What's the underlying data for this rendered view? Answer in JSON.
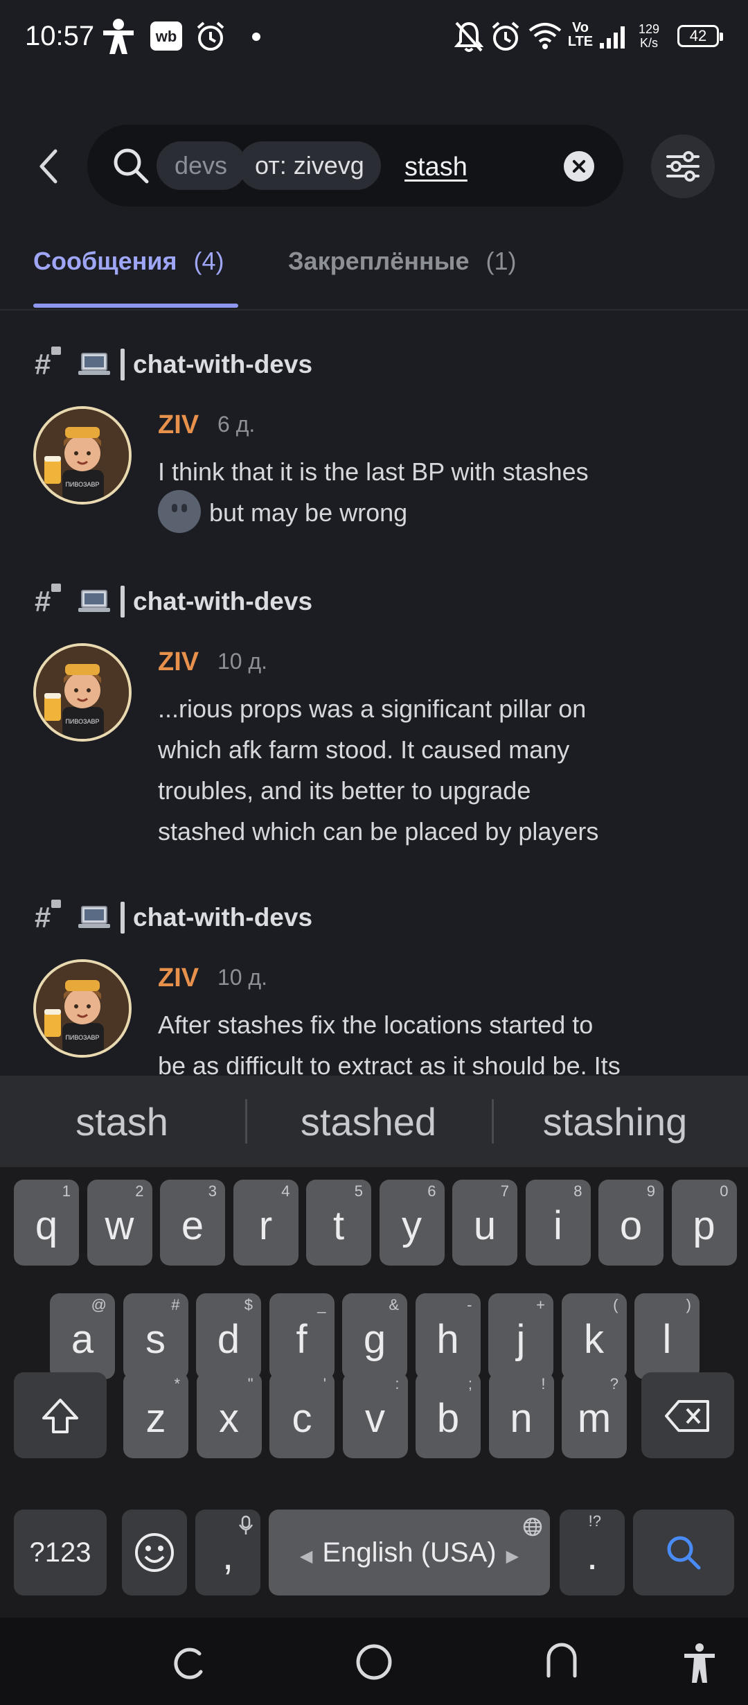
{
  "status_bar": {
    "time": "10:57",
    "network_speed_value": "129",
    "network_speed_unit": "K/s",
    "network_type": "Vo LTE",
    "battery": "42",
    "icons": [
      "person-icon",
      "wb-app-icon",
      "alarm-icon",
      "dot-icon",
      "notifications-off-icon",
      "alarm-icon",
      "wifi-icon",
      "signal-icon"
    ]
  },
  "search": {
    "channel_chip": "devs",
    "author_chip": "от: zivevg",
    "query": "stash"
  },
  "tabs": [
    {
      "label": "Сообщения",
      "count": "(4)",
      "active": true
    },
    {
      "label": "Закреплённые",
      "count": "(1)",
      "active": false
    }
  ],
  "results": [
    {
      "channel": "chat-with-devs",
      "author": "ZIV",
      "time": "6 д.",
      "lines": [
        "I think that it is the last BP with stashes",
        "but may be wrong"
      ],
      "emoji": "slightly-smiling-face"
    },
    {
      "channel": "chat-with-devs",
      "author": "ZIV",
      "time": "10 д.",
      "lines": [
        "...rious props was a significant pillar on",
        "which afk farm stood. It caused many",
        "troubles, and its better to upgrade",
        "stashed which can be placed by players"
      ]
    },
    {
      "channel": "chat-with-devs",
      "author": "ZIV",
      "time": "10 д.",
      "lines": [
        "After stashes fix the locations started to",
        "be as difficult to extract as it should be. Its"
      ]
    }
  ],
  "keyboard": {
    "suggestions": [
      "stash",
      "stashed",
      "stashing"
    ],
    "row1": [
      [
        "q",
        "1"
      ],
      [
        "w",
        "2"
      ],
      [
        "e",
        "3"
      ],
      [
        "r",
        "4"
      ],
      [
        "t",
        "5"
      ],
      [
        "y",
        "6"
      ],
      [
        "u",
        "7"
      ],
      [
        "i",
        "8"
      ],
      [
        "o",
        "9"
      ],
      [
        "p",
        "0"
      ]
    ],
    "row2": [
      [
        "a",
        "@"
      ],
      [
        "s",
        "#"
      ],
      [
        "d",
        "$"
      ],
      [
        "f",
        "_"
      ],
      [
        "g",
        "&"
      ],
      [
        "h",
        "-"
      ],
      [
        "j",
        "+"
      ],
      [
        "k",
        "("
      ],
      [
        "l",
        ")"
      ]
    ],
    "row3": [
      [
        "z",
        "*"
      ],
      [
        "x",
        "\""
      ],
      [
        "c",
        "'"
      ],
      [
        "v",
        ":"
      ],
      [
        "b",
        ";"
      ],
      [
        "n",
        "!"
      ],
      [
        "m",
        "?"
      ]
    ],
    "symbols_key": "?123",
    "comma": ",",
    "period": ".",
    "period_hint": "!?",
    "space_label": "English (USA)",
    "accent_color": "#4a8cf7"
  },
  "colors": {
    "background": "#1c1d22",
    "active_tab": "#9ea6f5",
    "author": "#e8914c"
  }
}
